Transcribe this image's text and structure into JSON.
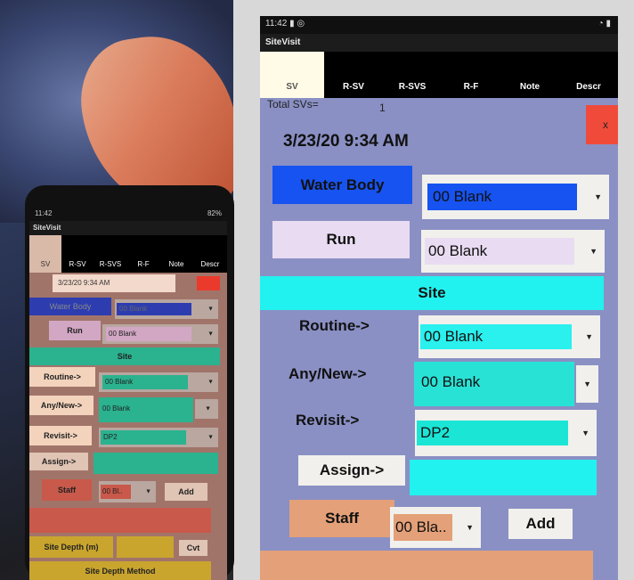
{
  "colors": {
    "tablet_bg": "#8a90c4",
    "water_body_btn": "#1753f0",
    "run_btn": "#e9dcf2",
    "site_bar": "#22f2ef",
    "routine_field": "#2af0ee",
    "anynew_field": "#29e2d6",
    "revisit_field": "#1be6d6",
    "staff_btn": "#e4a078",
    "close_btn": "#f04b3a"
  },
  "tablet": {
    "status_time": "11:42",
    "app_title": "SiteVisit",
    "tabs": [
      "SV",
      "R-SV",
      "R-SVS",
      "R-F",
      "Note",
      "Descr"
    ],
    "total_svs_label": "Total SVs=",
    "total_svs_value": "1",
    "close_label": "x",
    "datetime": "3/23/20 9:34 AM",
    "water_body_label": "Water Body",
    "water_body_value": "00 Blank",
    "run_label": "Run",
    "run_value": "00 Blank",
    "site_label": "Site",
    "routine_label": "Routine->",
    "routine_value": "00 Blank",
    "anynew_label": "Any/New->",
    "anynew_value": "00 Blank",
    "revisit_label": "Revisit->",
    "revisit_value": "DP2",
    "assign_label": "Assign->",
    "staff_label": "Staff",
    "staff_value": "00 Bla..",
    "add_label": "Add"
  },
  "phone": {
    "status_time": "11:42",
    "battery": "82%",
    "app_title": "SiteVisit",
    "tabs": [
      "SV",
      "R-SV",
      "R-SVS",
      "R-F",
      "Note",
      "Descr"
    ],
    "datetime": "3/23/20 9:34 AM",
    "water_body_label": "Water Body",
    "water_body_value": "00 Blank",
    "run_label": "Run",
    "run_value": "00 Blank",
    "site_label": "Site",
    "routine_label": "Routine->",
    "routine_value": "00 Blank",
    "anynew_label": "Any/New->",
    "anynew_value": "00 Blank",
    "revisit_label": "Revisit->",
    "revisit_value": "DP2",
    "assign_label": "Assign->",
    "staff_label": "Staff",
    "staff_value": "00 Bl..",
    "add_label": "Add",
    "site_depth_label": "Site Depth (m)",
    "cvt_label": "Cvt",
    "site_depth_method_label": "Site Depth Method"
  }
}
